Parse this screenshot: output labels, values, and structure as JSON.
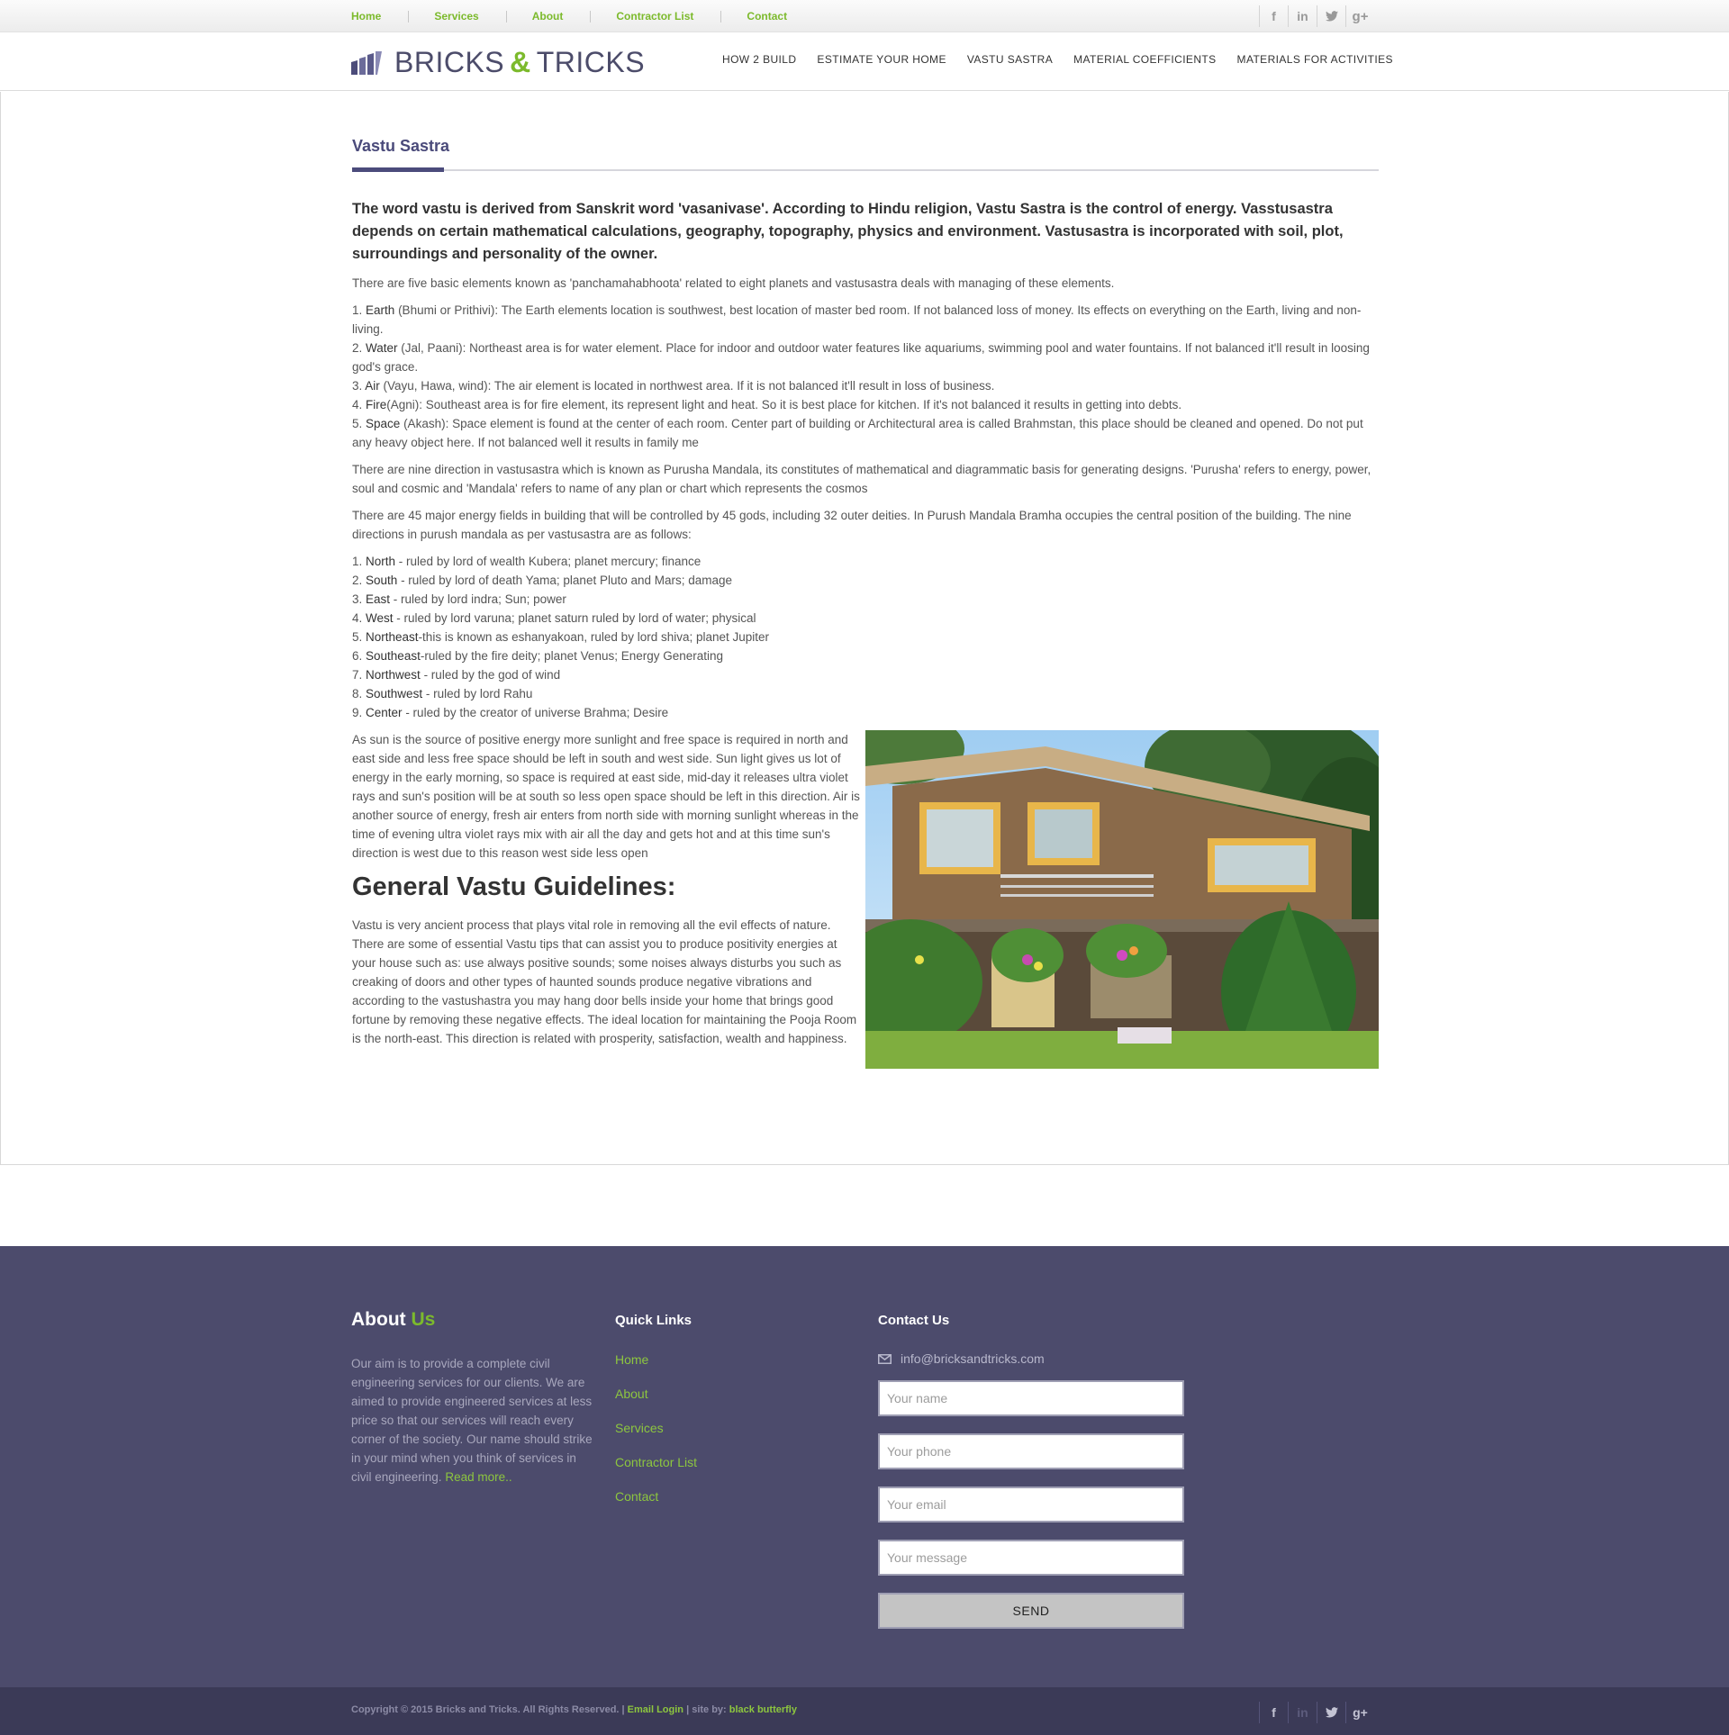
{
  "topbar": {
    "links": [
      "Home",
      "Services",
      "About",
      "Contractor List",
      "Contact"
    ],
    "social": [
      "f",
      "in",
      "t",
      "g+"
    ]
  },
  "header": {
    "logo_part1": "BRICKS",
    "logo_amp": "&",
    "logo_part2": "TRICKS",
    "nav": [
      "HOW 2 BUILD",
      "ESTIMATE YOUR HOME",
      "VASTU SASTRA",
      "MATERIAL COEFFICIENTS",
      "MATERIALS FOR ACTIVITIES"
    ]
  },
  "page": {
    "title": "Vastu Sastra",
    "lead": "The word vastu is derived from Sanskrit word 'vasanivase'. According to Hindu religion, Vastu Sastra is the control of energy. Vasstusastra depends on certain mathematical calculations, geography, topography, physics and environment. Vastusastra is incorporated with soil, plot, surroundings and personality of the owner.",
    "intro": "There are five basic elements known as 'panchamahabhoota' related to eight planets and vastusastra deals with managing of these elements.",
    "elements": [
      {
        "num": "1.",
        "name": "Earth",
        "text": " (Bhumi or Prithivi): The Earth elements location is southwest, best location of master bed room. If not balanced loss of money. Its effects on everything on the Earth, living and non-living."
      },
      {
        "num": "2.",
        "name": "Water",
        "text": " (Jal, Paani): Northeast area is for water element. Place for indoor and outdoor water features like aquariums, swimming pool and water fountains. If not balanced it'll result in loosing god's grace."
      },
      {
        "num": "3.",
        "name": "Air",
        "text": " (Vayu, Hawa, wind): The air element is located in northwest area. If it is not balanced it'll result in loss of business."
      },
      {
        "num": "4.",
        "name": "Fire",
        "text": "(Agni): Southeast area is for fire element, its represent light and heat. So it is best place for kitchen. If it's not balanced it results in getting into debts."
      },
      {
        "num": "5.",
        "name": "Space",
        "text": " (Akash): Space element is found at the center of each room. Center part of building or Architectural area is called Brahmstan, this place should be cleaned and opened. Do not put any heavy object here. If not balanced well it results in family me"
      }
    ],
    "directions_p1": "There are nine direction in vastusastra which is known as Purusha Mandala, its constitutes of mathematical and diagrammatic basis for generating designs. 'Purusha' refers to energy, power, soul and cosmic and 'Mandala' refers to name of any plan or chart which represents the cosmos",
    "directions_p2": "There are 45 major energy fields in building that will be controlled by 45 gods, including 32 outer deities. In Purush Mandala Bramha occupies the central position of the building. The nine directions in purush mandala as per vastusastra are as follows:",
    "directions": [
      {
        "num": "1.",
        "name": "North",
        "text": " - ruled by lord of wealth Kubera; planet mercury; finance"
      },
      {
        "num": "2.",
        "name": "South",
        "text": " - ruled by lord of death Yama; planet Pluto and Mars; damage"
      },
      {
        "num": "3.",
        "name": "East",
        "text": " - ruled by lord indra; Sun; power"
      },
      {
        "num": "4.",
        "name": "West",
        "text": " - ruled by lord varuna; planet saturn ruled by lord of water; physical"
      },
      {
        "num": "5.",
        "name": "Northeast",
        "text": "-this is known as eshanyakoan, ruled by lord shiva; planet Jupiter"
      },
      {
        "num": "6.",
        "name": "Southeast",
        "text": "-ruled by the fire deity; planet Venus; Energy Generating"
      },
      {
        "num": "7.",
        "name": "Northwest",
        "text": " - ruled by the god of wind"
      },
      {
        "num": "8.",
        "name": "Southwest",
        "text": " - ruled by lord Rahu"
      },
      {
        "num": "9.",
        "name": "Center",
        "text": " - ruled by the creator of universe Brahma; Desire"
      }
    ],
    "sun_text": "As sun is the source of positive energy more sunlight and free space is required in north and east side and less free space should be left in south and west side. Sun light gives us lot of energy in the early morning, so space is required at east side, mid-day it releases ultra violet rays and sun's position will be at south so less open space should be left in this direction. Air is another source of energy, fresh air enters from north side with morning sunlight whereas in the time of evening ultra violet rays mix with air all the day and gets hot and at this time sun's direction is west due to this reason west side less open",
    "guidelines_heading": "General Vastu Guidelines:",
    "guidelines_text": "Vastu is very ancient process that plays vital role in removing all the evil effects of nature. There are some of essential Vastu tips that can assist you to produce positivity energies at your house such as: use always positive sounds; some noises always disturbs you such as creaking of doors and other types of haunted sounds produce negative vibrations and according to the vastushastra you may hang door bells inside your home that brings good fortune by removing these negative effects. The ideal location for maintaining the Pooja Room is the north-east. This direction is related with prosperity, satisfaction, wealth and happiness."
  },
  "footer": {
    "about_heading_1": "About",
    "about_heading_2": "Us",
    "about_text": "Our aim is to provide a complete civil engineering services for our clients. We are aimed to provide engineered services at less price so that our services will reach every corner of the society. Our name should strike in your mind when you think of services in civil engineering.",
    "read_more": "Read more..",
    "quick_links_heading": "Quick Links",
    "quick_links": [
      "Home",
      "About",
      "Services",
      "Contractor List",
      "Contact"
    ],
    "contact_heading": "Contact Us",
    "email": "info@bricksandtricks.com",
    "form": {
      "name_placeholder": "Your name",
      "phone_placeholder": "Your phone",
      "email_placeholder": "Your email",
      "message_placeholder": "Your message",
      "send_label": "SEND"
    }
  },
  "bottombar": {
    "copyright": "Copyright © 2015 Bricks and Tricks. All Rights Reserved.",
    "sep1": " | ",
    "email_login": "Email Login",
    "sep2": " | site by: ",
    "site_by": "black butterfly",
    "social": [
      "f",
      "in",
      "t",
      "g+"
    ]
  },
  "colors": {
    "accent_green": "#7cba2c",
    "brand_purple": "#4c4b6c",
    "title_purple": "#4a4a7a",
    "bottom_bar": "#3b3a57"
  },
  "icons": [
    "logo-bars-icon",
    "facebook-icon",
    "linkedin-icon",
    "twitter-icon",
    "google-plus-icon",
    "envelope-icon"
  ]
}
